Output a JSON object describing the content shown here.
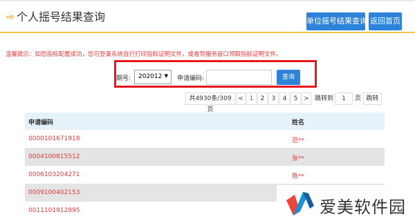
{
  "header": {
    "title_arrow": "⇨",
    "title": "个人摇号结果查询",
    "unit_query_button": "单位摇号结果查询",
    "home_button": "返回首页"
  },
  "notice": "温馨提示：如您指标配置成功，您可登录系统自行打印指标证明文件，或者到服务窗口领取指标证明文件。",
  "search": {
    "period_label": "期号:",
    "period_value": "202012",
    "code_label": "申请编码:",
    "code_value": "",
    "query_button": "查询"
  },
  "pagination": {
    "summary": "共4930条/309页",
    "prev": "<",
    "pages": [
      "1",
      "2",
      "3",
      "4",
      "5"
    ],
    "active_page": "1",
    "next": ">",
    "jump_label": "跳转到",
    "jump_value": "1",
    "page_unit": "页",
    "jump_button": "跳转"
  },
  "table": {
    "headers": [
      "申请编码",
      "姓名"
    ],
    "rows": [
      {
        "code": "0000101671918",
        "name": "范**"
      },
      {
        "code": "0004100815512",
        "name": "张**"
      },
      {
        "code": "0006103204271",
        "name": "熊**"
      },
      {
        "code": "0009100402153",
        "name": ""
      },
      {
        "code": "0011101912895",
        "name": ""
      }
    ]
  },
  "watermark": {
    "text": "爱美软件园"
  },
  "colors": {
    "accent_blue": "#2c83d9",
    "highlight_red": "#e8151b",
    "text_red": "#e23a3a",
    "header_underline": "#f5c24a"
  }
}
